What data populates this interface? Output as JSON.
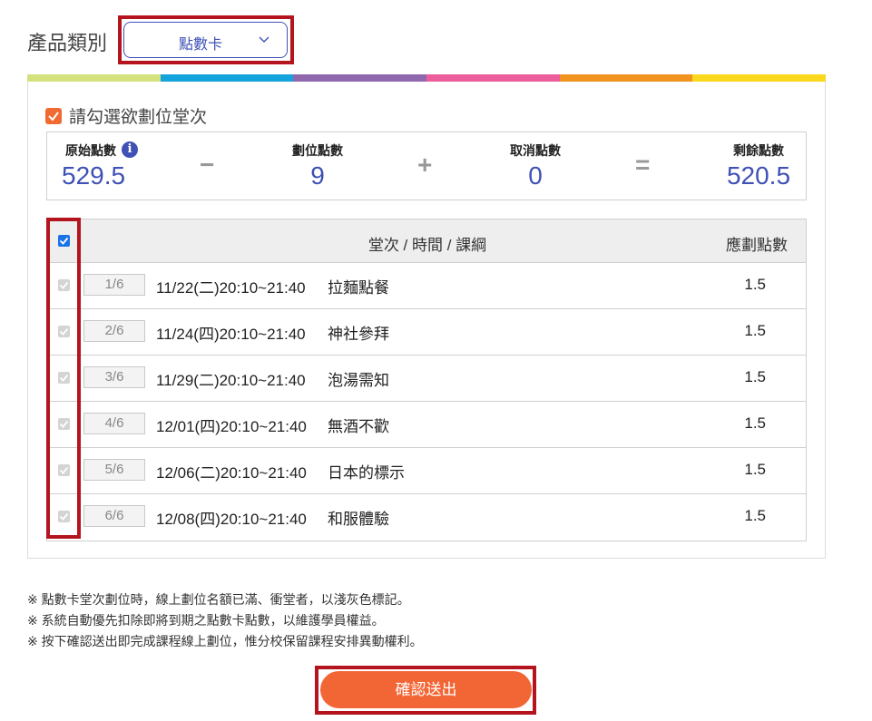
{
  "product": {
    "label": "產品類別",
    "selected": "點數卡"
  },
  "stripe_colors": [
    "#d4e17d",
    "#15a3dd",
    "#8e67ac",
    "#ec5d9b",
    "#f0941f",
    "#fad81e"
  ],
  "colors": {
    "accent_blue": "#3f51b5",
    "accent_orange": "#f26636",
    "highlight_red": "#b4141e"
  },
  "select_all": {
    "label": "請勾選欲劃位堂次"
  },
  "summary": {
    "original": {
      "title": "原始點數",
      "value": "529.5"
    },
    "op1": "−",
    "booked": {
      "title": "劃位點數",
      "value": "9"
    },
    "op2": "+",
    "cancelled": {
      "title": "取消點數",
      "value": "0"
    },
    "op3": "=",
    "remaining": {
      "title": "剩餘點數",
      "value": "520.5"
    }
  },
  "table": {
    "header_main": "堂次 / 時間 / 課綱",
    "header_points": "應劃點數",
    "rows": [
      {
        "seq": "1/6",
        "time": "11/22(二)20:10~21:40",
        "topic": "拉麵點餐",
        "points": "1.5"
      },
      {
        "seq": "2/6",
        "time": "11/24(四)20:10~21:40",
        "topic": "神社參拜",
        "points": "1.5"
      },
      {
        "seq": "3/6",
        "time": "11/29(二)20:10~21:40",
        "topic": "泡湯需知",
        "points": "1.5"
      },
      {
        "seq": "4/6",
        "time": "12/01(四)20:10~21:40",
        "topic": "無酒不歡",
        "points": "1.5"
      },
      {
        "seq": "5/6",
        "time": "12/06(二)20:10~21:40",
        "topic": "日本的標示",
        "points": "1.5"
      },
      {
        "seq": "6/6",
        "time": "12/08(四)20:10~21:40",
        "topic": "和服體驗",
        "points": "1.5"
      }
    ]
  },
  "notes": [
    "※ 點數卡堂次劃位時，線上劃位名額已滿、衝堂者，以淺灰色標記。",
    "※ 系統自動優先扣除即將到期之點數卡點數，以維護學員權益。",
    "※ 按下確認送出即完成課程線上劃位，惟分校保留課程安排異動權利。"
  ],
  "submit_label": "確認送出"
}
